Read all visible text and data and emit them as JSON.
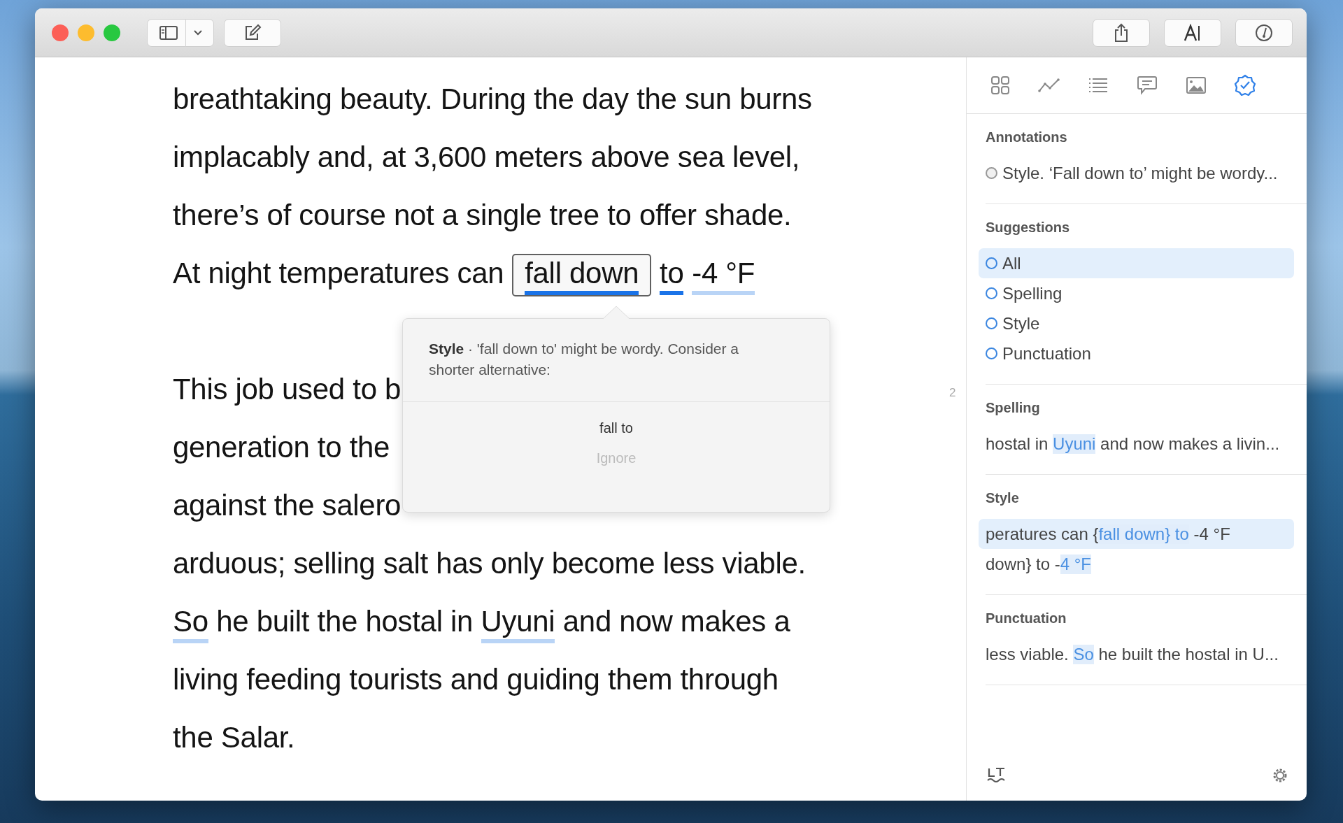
{
  "editor": {
    "paragraphs": [
      {
        "lines": [
          [
            {
              "text": "breathtaking beauty. During the day the sun burns"
            }
          ],
          [
            {
              "text": "implacably and, at 3,600 meters above sea level,"
            }
          ],
          [
            {
              "text": "there’s of course not a single tree to offer shade."
            }
          ],
          [
            {
              "text": "At night temperatures can"
            },
            {
              "text": "fall down",
              "boxed": true,
              "color": "#1a73e8"
            },
            {
              "text": "to",
              "color": "#1a73e8"
            },
            {
              "text": "-4 °F",
              "color": "#b9d4f6"
            }
          ]
        ]
      },
      {
        "lines": [
          [
            {
              "text": "This job used to b"
            }
          ],
          [
            {
              "text": "generation to the"
            }
          ],
          [
            {
              "text": "against the salero"
            }
          ],
          [
            {
              "text": "arduous; selling salt has only become less viable."
            }
          ],
          [
            {
              "text": "So",
              "color": "#b9d4f6"
            },
            {
              "text": " he built the hostal in "
            },
            {
              "text": "Uyuni",
              "color": "#b9d4f6"
            },
            {
              "text": " and now makes a"
            }
          ],
          [
            {
              "text": "living feeding tourists and guiding them through"
            }
          ],
          [
            {
              "text": "the Salar."
            }
          ]
        ]
      }
    ],
    "page_number": "2"
  },
  "popover": {
    "message": "**Style** · 'fall down to' might be wordy. Consider a shorter alternative:",
    "suggestion": "fall to",
    "ignore": "Ignore"
  },
  "sidebar": {
    "tabs": [
      {
        "kind": "grid",
        "selected": false
      },
      {
        "kind": "chart",
        "selected": false
      },
      {
        "kind": "list",
        "selected": false
      },
      {
        "kind": "comment",
        "selected": false
      },
      {
        "kind": "image",
        "selected": false
      },
      {
        "kind": "check",
        "selected": true
      }
    ],
    "annotations": {
      "heading": "Annotations",
      "items": [
        "Style. ‘Fall down to’ might be wordy..."
      ]
    },
    "suggestions": {
      "heading": "Suggestions",
      "filters": [
        {
          "label": "All",
          "selected": true
        },
        {
          "label": "Spelling",
          "selected": false
        },
        {
          "label": "Style",
          "selected": false
        },
        {
          "label": "Punctuation",
          "selected": false
        }
      ]
    },
    "sections": [
      {
        "heading": "Spelling",
        "items": [
          {
            "selected": false,
            "segments": [
              {
                "text": "hostal in "
              },
              {
                "text": "Uyuni",
                "highlight": true
              },
              {
                "text": " and now makes a livin..."
              }
            ]
          }
        ]
      },
      {
        "heading": "Style",
        "items": [
          {
            "selected": true,
            "segments": [
              {
                "text": "peratures can {"
              },
              {
                "text": "fall down} to",
                "highlight": true
              },
              {
                "text": " -4 °F"
              }
            ]
          },
          {
            "selected": false,
            "segments": [
              {
                "text": "down} to -"
              },
              {
                "text": "4 °F",
                "highlight": true
              }
            ]
          }
        ]
      },
      {
        "heading": "Punctuation",
        "items": [
          {
            "selected": false,
            "segments": [
              {
                "text": "less viable. "
              },
              {
                "text": "So",
                "highlight": true
              },
              {
                "text": " he built the hostal in U..."
              }
            ]
          }
        ]
      }
    ]
  }
}
